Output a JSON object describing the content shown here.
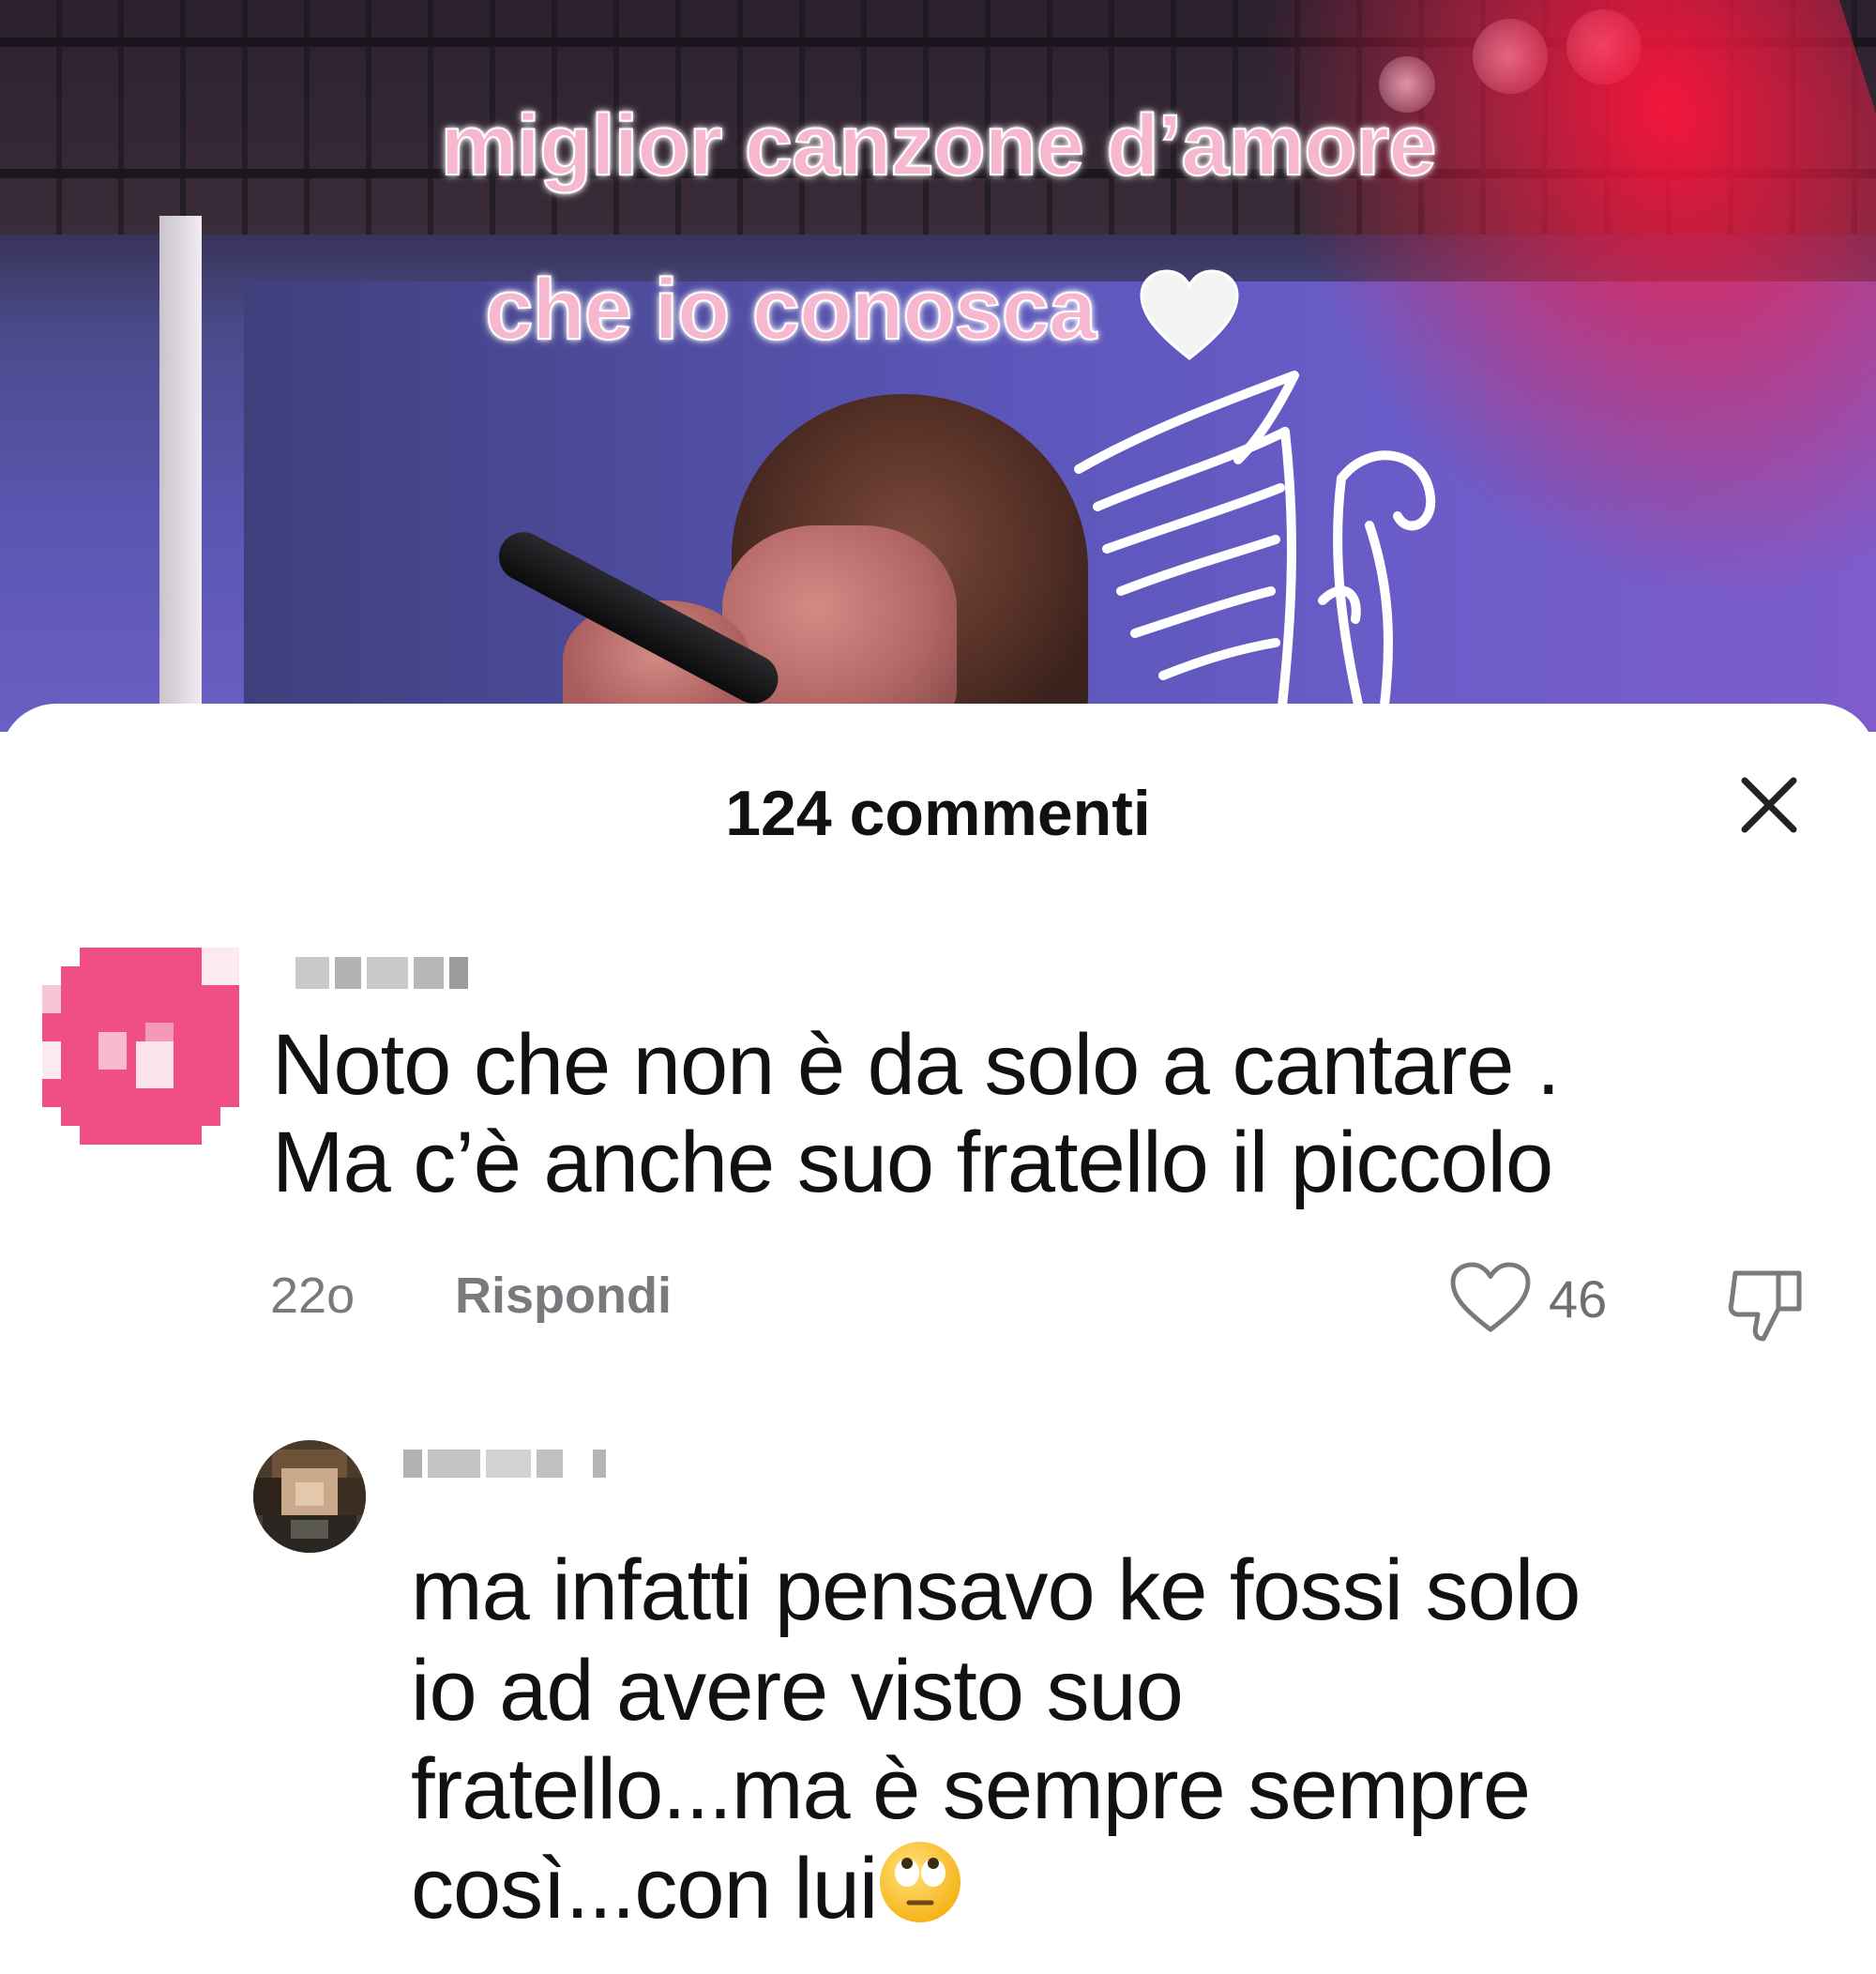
{
  "video": {
    "caption_line1": "miglior canzone d’amore",
    "caption_line2": "che io conosca",
    "caption_heart_icon": "white-heart-icon"
  },
  "comments_panel": {
    "title": "124 commenti",
    "close_icon": "close-icon"
  },
  "comments": [
    {
      "username": "",
      "avatar_color": "#ef4f86",
      "text_line1": "Noto che non è da solo a cantare .",
      "text_line2": "Ma c’è anche suo fratello il piccolo",
      "time": "22o",
      "reply_label": "Rispondi",
      "likes": "46",
      "like_icon": "heart-outline-icon",
      "dislike_icon": "thumbs-down-icon"
    },
    {
      "username": "",
      "text_line1": "ma infatti pensavo ke fossi solo",
      "text_line2": "io ad avere visto suo",
      "text_line3": "fratello...ma è sempre sempre",
      "text_line4": "così...con lui",
      "emoji": "🙄"
    }
  ],
  "colors": {
    "caption_pink": "#f6b7cf",
    "text_dark": "#111111",
    "meta_gray": "#7a7a7e"
  }
}
